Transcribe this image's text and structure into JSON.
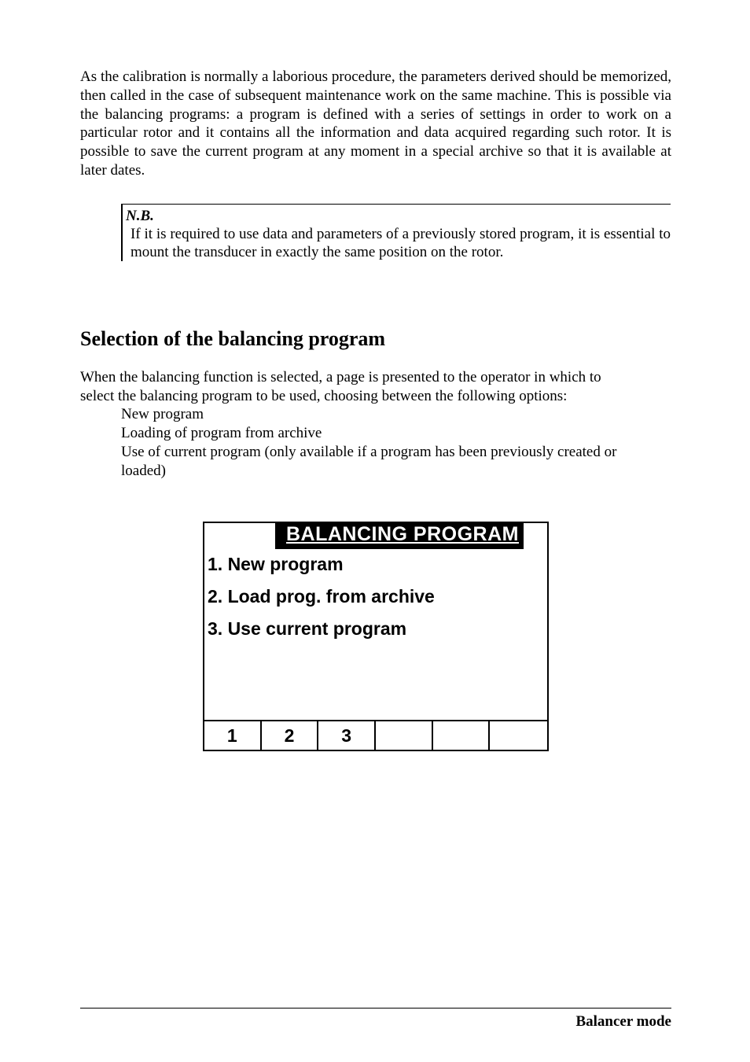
{
  "intro_paragraph": "As the calibration is normally a laborious procedure, the parameters derived should be memorized, then called in the case of subsequent maintenance work on the same machine. This is possible via the balancing programs: a program is defined with a series of settings in order to work on a particular rotor and it contains all the information and data acquired regarding such rotor. It is possible to save the current program at any moment in a special archive so that it is available at later dates.",
  "note": {
    "heading": "N.B.",
    "text": "If it is required to use data and parameters of a previously stored program, it is essential to mount the transducer in exactly the same position on the rotor."
  },
  "section_heading": "Selection of the balancing program",
  "section_intro_lines": [
    "When the balancing function is selected, a page is presented to the operator in which to",
    "select the balancing program to be used, choosing between the following options:"
  ],
  "options": [
    "New program",
    "Loading of program from archive",
    "Use of current program (only available if a program has been previously created or",
    "loaded)"
  ],
  "screen": {
    "title": "BALANCING PROGRAM",
    "items": [
      "1. New program",
      "2. Load prog. from archive",
      "3. Use current program"
    ],
    "footer": [
      "1",
      "2",
      "3",
      "",
      "",
      ""
    ]
  },
  "footer": "Balancer mode"
}
